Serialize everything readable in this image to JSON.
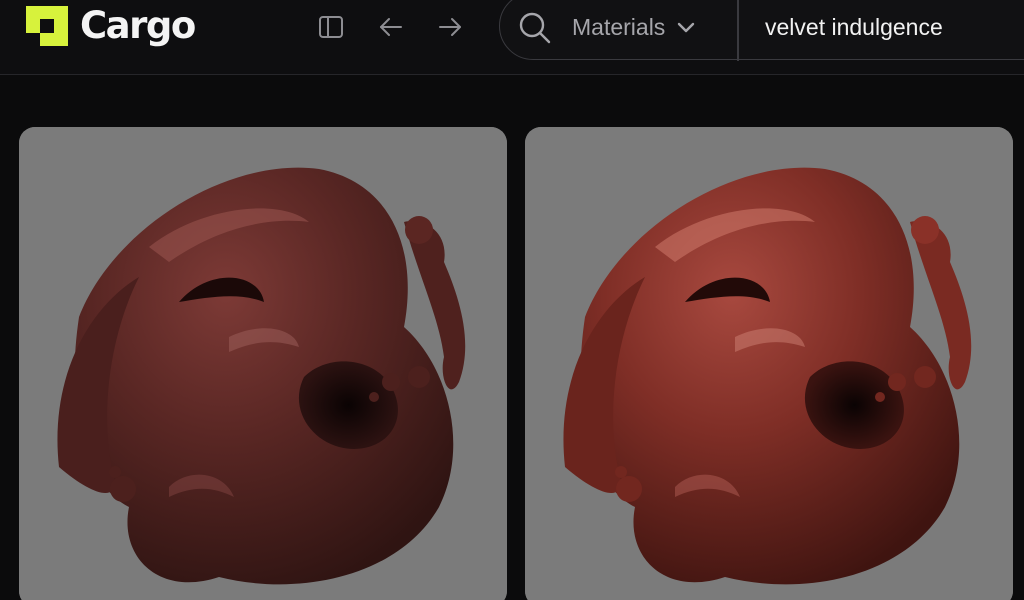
{
  "app": {
    "name": "Cargo"
  },
  "header": {
    "category": "Materials",
    "query": "velvet indulgence"
  },
  "icons": {
    "logo": "cargo-logo-mark",
    "sidebar_toggle": "sidebar-panel-icon",
    "back": "arrow-left-icon",
    "forward": "arrow-right-icon",
    "search": "search-icon",
    "dropdown": "chevron-down-icon"
  },
  "colors": {
    "accent": "#d7f23c",
    "background": "#0b0b0c",
    "card_background": "#7b7b7b",
    "chocolate_dark": "#4a1f1d",
    "chocolate_warm": "#7a2a22"
  },
  "results": [
    {
      "alt": "dark chocolate liquid swirl sphere",
      "tone": "dark"
    },
    {
      "alt": "warm reddish chocolate liquid swirl sphere",
      "tone": "warm"
    }
  ]
}
